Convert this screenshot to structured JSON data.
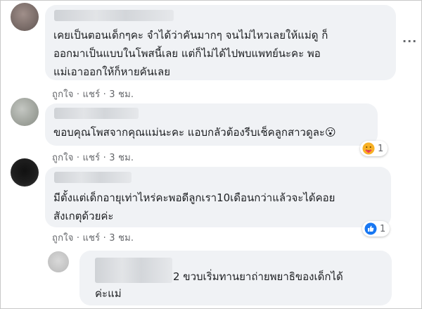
{
  "comments": [
    {
      "lines": [
        "เคยเป็นตอนเด็กๆคะ จำได้ว่าคันมากๆ จนไม่ไหวเลยให้แม่ดู ก็",
        "ออกมาเป็นแบบในโพสนี้เลย แต่ก็ไม่ได้ไปพบแพทย์นะคะ พอ",
        "แม่เอาออกให้ก็หายคันเลย"
      ],
      "actions": "ถูกใจ · แชร์ · 3 ชม."
    },
    {
      "lines": [
        "ขอบคุณโพสจากคุณแม่นะคะ แอบกลัวต้องรีบเช็คลูกสาวดูละ😮"
      ],
      "actions": "ถูกใจ · แชร์ · 3 ชม.",
      "reaction": {
        "icon": "care-reaction-icon",
        "count": "1"
      }
    },
    {
      "lines": [
        "มีตั้งแต่เด็กอายุเท่าไหร่คะพอดีลูกเรา10เดือนกว่าแล้วจะได้คอย",
        "สังเกตุด้วยค่ะ"
      ],
      "actions": "ถูกใจ · แชร์ · 3 ชม.",
      "reaction": {
        "icon": "like-reaction-icon",
        "count": "1"
      }
    },
    {
      "lines": [
        "2 ขวบเริ่มทานยาถ่ายพยาธิของเด็กได้",
        "ค่ะแม่"
      ]
    }
  ],
  "more_icon": "more-options-icon",
  "colors": {
    "bubble": "#f0f2f5",
    "meta": "#65676b",
    "like_blue": "#1877f2",
    "care_yellow": "#f7b125"
  }
}
